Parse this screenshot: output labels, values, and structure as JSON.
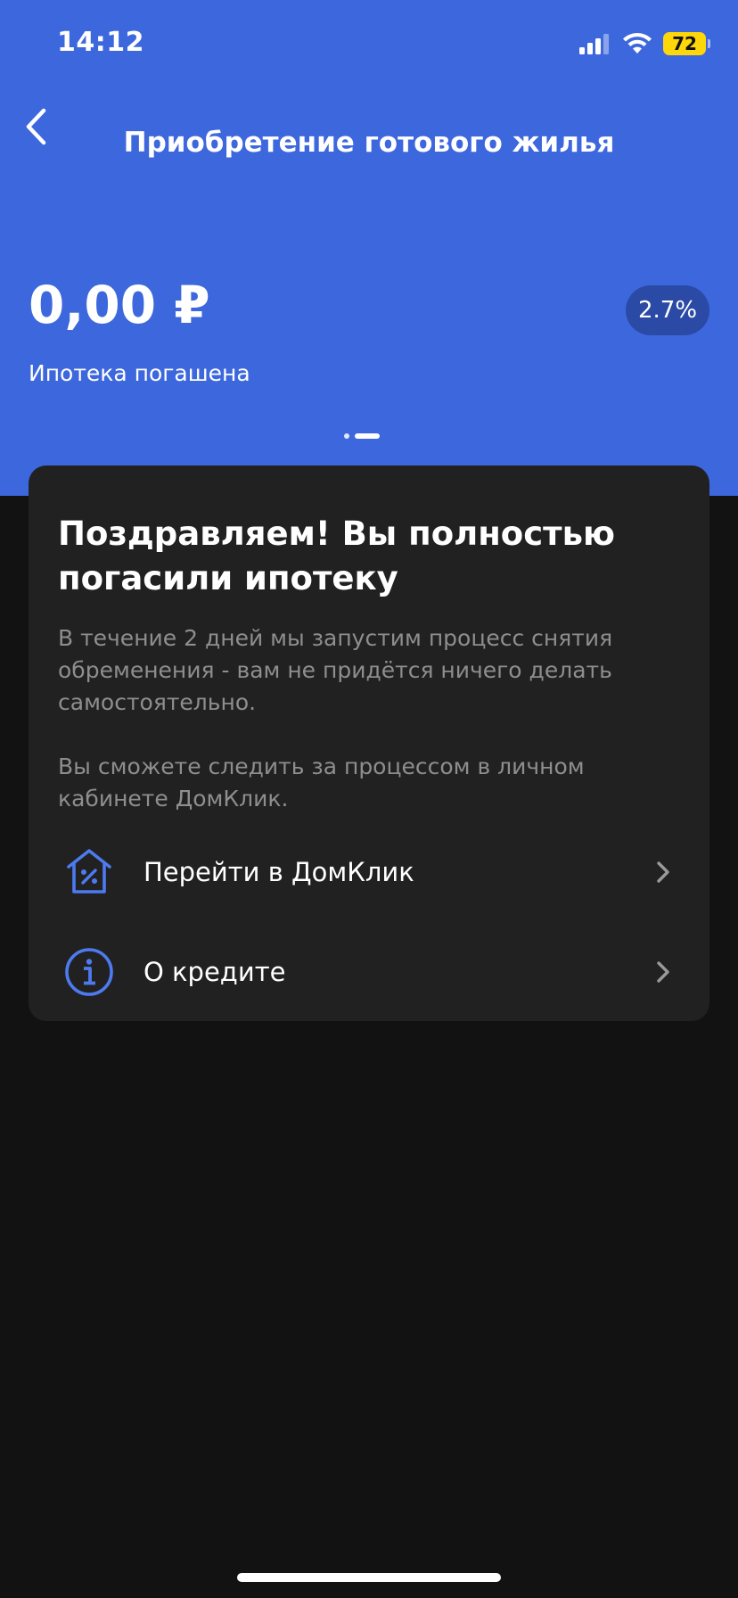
{
  "status_bar": {
    "time": "14:12",
    "battery": "72",
    "icons": [
      "signal-icon",
      "wifi-icon",
      "battery-icon"
    ]
  },
  "header": {
    "back_icon": "chevron-left-icon",
    "title": "Приобретение готового жилья"
  },
  "loan": {
    "amount": "0,00 ₽",
    "rate": "2.7%",
    "status": "Ипотека погашена",
    "pager": {
      "count": 2,
      "active": 1
    }
  },
  "card": {
    "title": "Поздравляем! Вы полностью погасили ипотеку",
    "paragraph1": "В течение 2 дней мы запустим процесс снятия обременения - вам не придётся ничего делать самостоятельно.",
    "paragraph2": "Вы сможете следить за процессом в личном кабинете ДомКлик.",
    "actions": [
      {
        "label": "Перейти в ДомКлик",
        "icon": "house-percent-icon"
      },
      {
        "label": "О кредите",
        "icon": "info-icon"
      }
    ]
  },
  "colors": {
    "hero_bg": "#3d67dd",
    "badge_bg": "#2a4aa6",
    "card_bg": "#212121",
    "page_bg": "#121212",
    "icon_accent": "#4e7af0",
    "battery": "#ffd60a"
  }
}
